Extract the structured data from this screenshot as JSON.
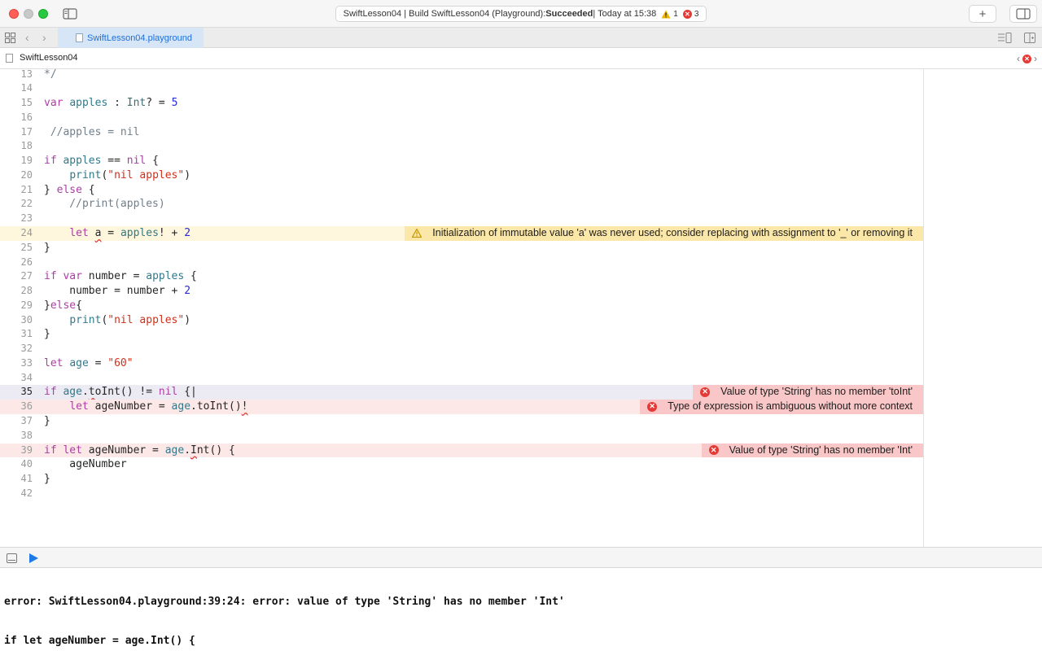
{
  "titlebar": {
    "status_prefix": "SwiftLesson04 | Build SwiftLesson04 (Playground): ",
    "status_result": "Succeeded",
    "status_suffix": " | Today at 15:38",
    "warning_count": "1",
    "error_count": "3",
    "add_label": "+"
  },
  "tabs": [
    {
      "label": "SwiftLesson04.playground"
    }
  ],
  "breadcrumb": {
    "label": "SwiftLesson04"
  },
  "editor": {
    "lines": [
      {
        "n": "13",
        "state": "",
        "code": [
          [
            "cm",
            "*/"
          ]
        ]
      },
      {
        "n": "14",
        "state": "",
        "code": []
      },
      {
        "n": "15",
        "state": "",
        "code": [
          [
            "kw",
            "var"
          ],
          [
            "op",
            " "
          ],
          [
            "id",
            "apples"
          ],
          [
            "op",
            " : "
          ],
          [
            "ty",
            "Int"
          ],
          [
            "op",
            "? = "
          ],
          [
            "num",
            "5"
          ]
        ]
      },
      {
        "n": "16",
        "state": "",
        "code": []
      },
      {
        "n": "17",
        "state": "",
        "code": [
          [
            "cm",
            " //apples = nil"
          ]
        ]
      },
      {
        "n": "18",
        "state": "",
        "code": []
      },
      {
        "n": "19",
        "state": "",
        "code": [
          [
            "kw",
            "if"
          ],
          [
            "op",
            " "
          ],
          [
            "id",
            "apples"
          ],
          [
            "op",
            " == "
          ],
          [
            "kw",
            "nil"
          ],
          [
            "op",
            " {"
          ]
        ]
      },
      {
        "n": "20",
        "state": "",
        "code": [
          [
            "op",
            "    "
          ],
          [
            "id",
            "print"
          ],
          [
            "op",
            "("
          ],
          [
            "str",
            "\"nil apples\""
          ],
          [
            "op",
            ")"
          ]
        ]
      },
      {
        "n": "21",
        "state": "",
        "code": [
          [
            "op",
            "} "
          ],
          [
            "kw",
            "else"
          ],
          [
            "op",
            " {"
          ]
        ]
      },
      {
        "n": "22",
        "state": "",
        "code": [
          [
            "cm",
            "    //print(apples)"
          ]
        ]
      },
      {
        "n": "23",
        "state": "",
        "code": []
      },
      {
        "n": "24",
        "state": "warn",
        "code": [
          [
            "op",
            "    "
          ],
          [
            "kw",
            "let"
          ],
          [
            "op",
            " "
          ],
          [
            "sq",
            "a"
          ],
          [
            "op",
            " = "
          ],
          [
            "id",
            "apples"
          ],
          [
            "op",
            "! + "
          ],
          [
            "num",
            "2"
          ]
        ],
        "message": "Initialization of immutable value 'a' was never used; consider replacing with assignment to '_' or removing it"
      },
      {
        "n": "25",
        "state": "",
        "code": [
          [
            "op",
            "}"
          ]
        ]
      },
      {
        "n": "26",
        "state": "",
        "code": []
      },
      {
        "n": "27",
        "state": "",
        "code": [
          [
            "kw",
            "if"
          ],
          [
            "op",
            " "
          ],
          [
            "kw",
            "var"
          ],
          [
            "op",
            " number = "
          ],
          [
            "id",
            "apples"
          ],
          [
            "op",
            " {"
          ]
        ]
      },
      {
        "n": "28",
        "state": "",
        "code": [
          [
            "op",
            "    number = number + "
          ],
          [
            "num",
            "2"
          ]
        ]
      },
      {
        "n": "29",
        "state": "",
        "code": [
          [
            "op",
            "}"
          ],
          [
            "kw",
            "else"
          ],
          [
            "op",
            "{"
          ]
        ]
      },
      {
        "n": "30",
        "state": "",
        "code": [
          [
            "op",
            "    "
          ],
          [
            "id",
            "print"
          ],
          [
            "op",
            "("
          ],
          [
            "str",
            "\"nil apples\""
          ],
          [
            "op",
            ")"
          ]
        ]
      },
      {
        "n": "31",
        "state": "",
        "code": [
          [
            "op",
            "}"
          ]
        ]
      },
      {
        "n": "32",
        "state": "",
        "code": []
      },
      {
        "n": "33",
        "state": "",
        "code": [
          [
            "kw",
            "let"
          ],
          [
            "op",
            " "
          ],
          [
            "id",
            "age"
          ],
          [
            "op",
            " = "
          ],
          [
            "str",
            "\"60\""
          ]
        ]
      },
      {
        "n": "34",
        "state": "",
        "code": []
      },
      {
        "n": "35",
        "state": "current",
        "code": [
          [
            "kw",
            "if"
          ],
          [
            "op",
            " "
          ],
          [
            "id",
            "age"
          ],
          [
            "op",
            "."
          ],
          [
            "sq",
            "t"
          ],
          [
            "op",
            "oInt() != "
          ],
          [
            "kw",
            "nil"
          ],
          [
            "op",
            " {|"
          ]
        ],
        "message": "Value of type 'String' has no member 'toInt'"
      },
      {
        "n": "36",
        "state": "error",
        "code": [
          [
            "op",
            "    "
          ],
          [
            "kw",
            "let"
          ],
          [
            "op",
            " ageNumber = "
          ],
          [
            "id",
            "age"
          ],
          [
            "op",
            ".toInt()"
          ],
          [
            "sq",
            "!"
          ]
        ],
        "message": "Type of expression is ambiguous without more context"
      },
      {
        "n": "37",
        "state": "",
        "code": [
          [
            "op",
            "}"
          ]
        ]
      },
      {
        "n": "38",
        "state": "",
        "code": []
      },
      {
        "n": "39",
        "state": "error",
        "code": [
          [
            "kw",
            "if"
          ],
          [
            "op",
            " "
          ],
          [
            "kw",
            "let"
          ],
          [
            "op",
            " ageNumber = "
          ],
          [
            "id",
            "age"
          ],
          [
            "op",
            "."
          ],
          [
            "sq",
            "I"
          ],
          [
            "op",
            "nt() {"
          ]
        ],
        "message": "Value of type 'String' has no member 'Int'"
      },
      {
        "n": "40",
        "state": "",
        "code": [
          [
            "op",
            "    ageNumber"
          ]
        ]
      },
      {
        "n": "41",
        "state": "",
        "code": [
          [
            "op",
            "}"
          ]
        ]
      },
      {
        "n": "42",
        "state": "",
        "code": []
      }
    ]
  },
  "console": {
    "lines": [
      "error: SwiftLesson04.playground:39:24: error: value of type 'String' has no member 'Int'",
      "if let ageNumber = age.Int() {",
      "                   ~~~ ^~~"
    ]
  },
  "colors": {
    "warning_bg": "#fef6dd",
    "warning_badge": "#fbe7a7",
    "error_bg": "#fde8e8",
    "error_badge": "#f9c7c7",
    "accent": "#1e7ae6"
  }
}
